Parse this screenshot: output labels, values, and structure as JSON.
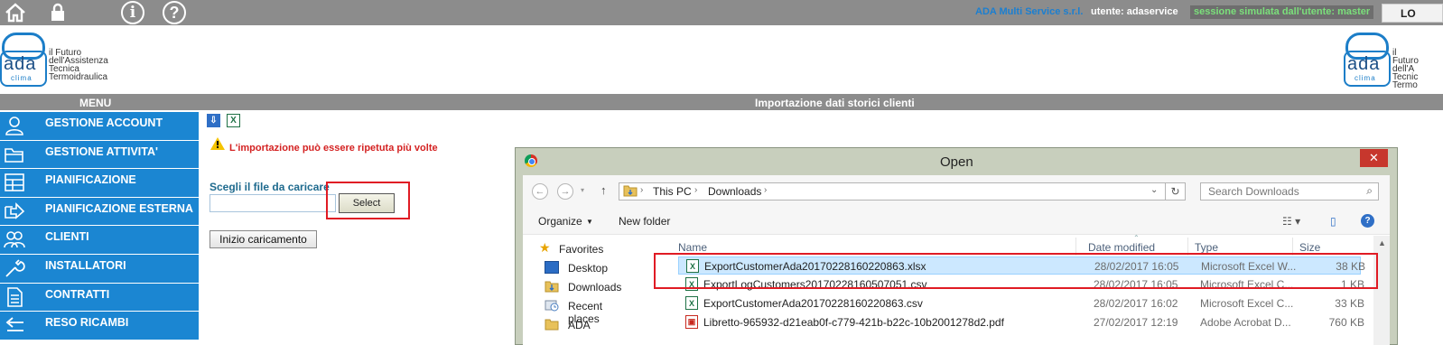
{
  "topbar": {
    "company": "ADA Multi Service s.r.l.",
    "user": "utente: adaservice",
    "session": "sessione simulata dall'utente: master",
    "logout": "LO",
    "info_glyph": "i",
    "help_glyph": "?"
  },
  "logo": {
    "brand": "ada",
    "sub": "clima",
    "tagline": [
      "il Futuro",
      "dell'Assistenza",
      "Tecnica",
      "Termoidraulica"
    ],
    "tagline_right": [
      "il Futuro",
      "dell'A",
      "Tecnic",
      "Termo"
    ]
  },
  "section": {
    "menu_label": "MENU",
    "title": "Importazione dati storici clienti"
  },
  "menu": {
    "items": [
      {
        "label": "GESTIONE ACCOUNT",
        "icon": "user-icon"
      },
      {
        "label": "GESTIONE ATTIVITA'",
        "icon": "folder-icon"
      },
      {
        "label": "PIANIFICAZIONE",
        "icon": "grid-icon"
      },
      {
        "label": "PIANIFICAZIONE ESTERNA",
        "icon": "arrow-out-icon"
      },
      {
        "label": "CLIENTI",
        "icon": "users-icon"
      },
      {
        "label": "INSTALLATORI",
        "icon": "wrench-icon"
      },
      {
        "label": "CONTRATTI",
        "icon": "document-icon"
      },
      {
        "label": "RESO RICAMBI",
        "icon": "return-icon"
      }
    ]
  },
  "main": {
    "warning": "L'importazione può essere ripetuta più volte",
    "choose_label": "Scegli il file da caricare",
    "file_value": "",
    "select_button": "Select",
    "start_button": "Inizio caricamento"
  },
  "dialog": {
    "title": "Open",
    "close": "✕",
    "breadcrumb": [
      "This PC",
      "Downloads"
    ],
    "search_placeholder": "Search Downloads",
    "organize": "Organize",
    "new_folder": "New folder",
    "nav": [
      {
        "label": "Favorites",
        "icon": "star-icon"
      },
      {
        "label": "Desktop",
        "icon": "desktop-icon"
      },
      {
        "label": "Downloads",
        "icon": "downloads-folder-icon"
      },
      {
        "label": "Recent places",
        "icon": "recent-icon"
      },
      {
        "label": "ADA",
        "icon": "folder-icon"
      }
    ],
    "columns": {
      "name": "Name",
      "date": "Date modified",
      "type": "Type",
      "size": "Size"
    },
    "files": [
      {
        "name": "ExportCustomerAda20170228160220863.xlsx",
        "date": "28/02/2017 16:05",
        "type": "Microsoft Excel W...",
        "size": "38 KB",
        "icon": "excel-icon",
        "selected": true
      },
      {
        "name": "ExportLogCustomers20170228160507051.csv",
        "date": "28/02/2017 16:05",
        "type": "Microsoft Excel C...",
        "size": "1 KB",
        "icon": "excel-icon",
        "selected": false
      },
      {
        "name": "ExportCustomerAda20170228160220863.csv",
        "date": "28/02/2017 16:02",
        "type": "Microsoft Excel C...",
        "size": "33 KB",
        "icon": "excel-icon",
        "selected": false
      },
      {
        "name": "Libretto-965932-d21eab0f-c779-421b-b22c-10b2001278d2.pdf",
        "date": "27/02/2017 12:19",
        "type": "Adobe Acrobat D...",
        "size": "760 KB",
        "icon": "pdf-icon",
        "selected": false
      }
    ]
  },
  "colors": {
    "menu_bg": "#1b86d2",
    "bar_bg": "#8c8c8c",
    "warning": "#d42222",
    "highlight": "#e01b24",
    "selection": "#cce8ff"
  }
}
